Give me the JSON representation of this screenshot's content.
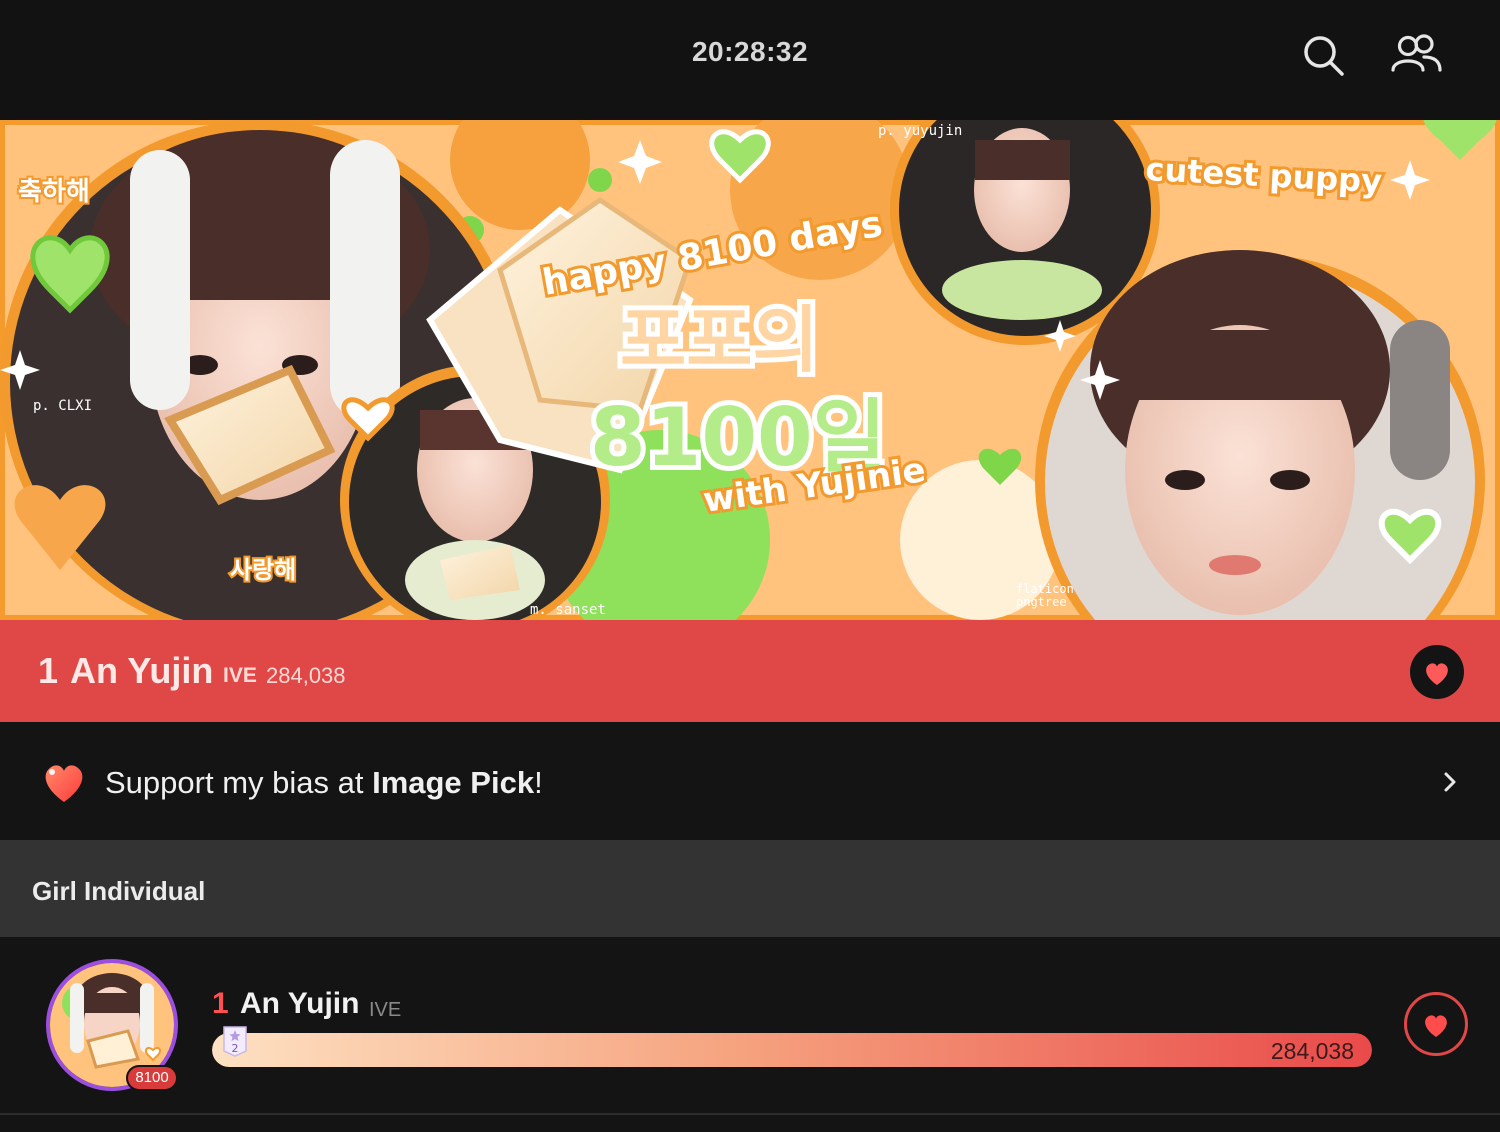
{
  "status_bar": {
    "time": "20:28:32"
  },
  "header": {
    "search_icon": "search-icon",
    "community_icon": "people-icon"
  },
  "banner": {
    "texts": {
      "congrats_ko": "축하해",
      "love_ko": "사랑해",
      "happy_days": "happy 8100 days",
      "title_ko_1": "포포의",
      "title_ko_2": "8100일",
      "with_name": "with Yujinie",
      "cutest": "cutest puppy",
      "credit_1": "p. CLXI",
      "credit_2": "p. yuyujin",
      "credit_3": "m. sanset",
      "credit_4": "flaticon",
      "credit_5": "pngtree"
    },
    "colors": {
      "bg": "#ffc37e",
      "green": "#8fe05a",
      "orange": "#f39a2e"
    }
  },
  "top_rank": {
    "rank": "1",
    "name": "An Yujin",
    "group": "IVE",
    "votes": "284,038",
    "accent": "#e04848"
  },
  "support": {
    "text_prefix": "Support my bias at ",
    "text_bold": "Image Pick",
    "text_suffix": "!"
  },
  "section": {
    "title": "Girl Individual"
  },
  "ranking_list": [
    {
      "rank": "1",
      "name": "An Yujin",
      "group": "IVE",
      "votes": "284,038",
      "badge": "8100",
      "tag": "2",
      "progress": 1.0
    }
  ]
}
